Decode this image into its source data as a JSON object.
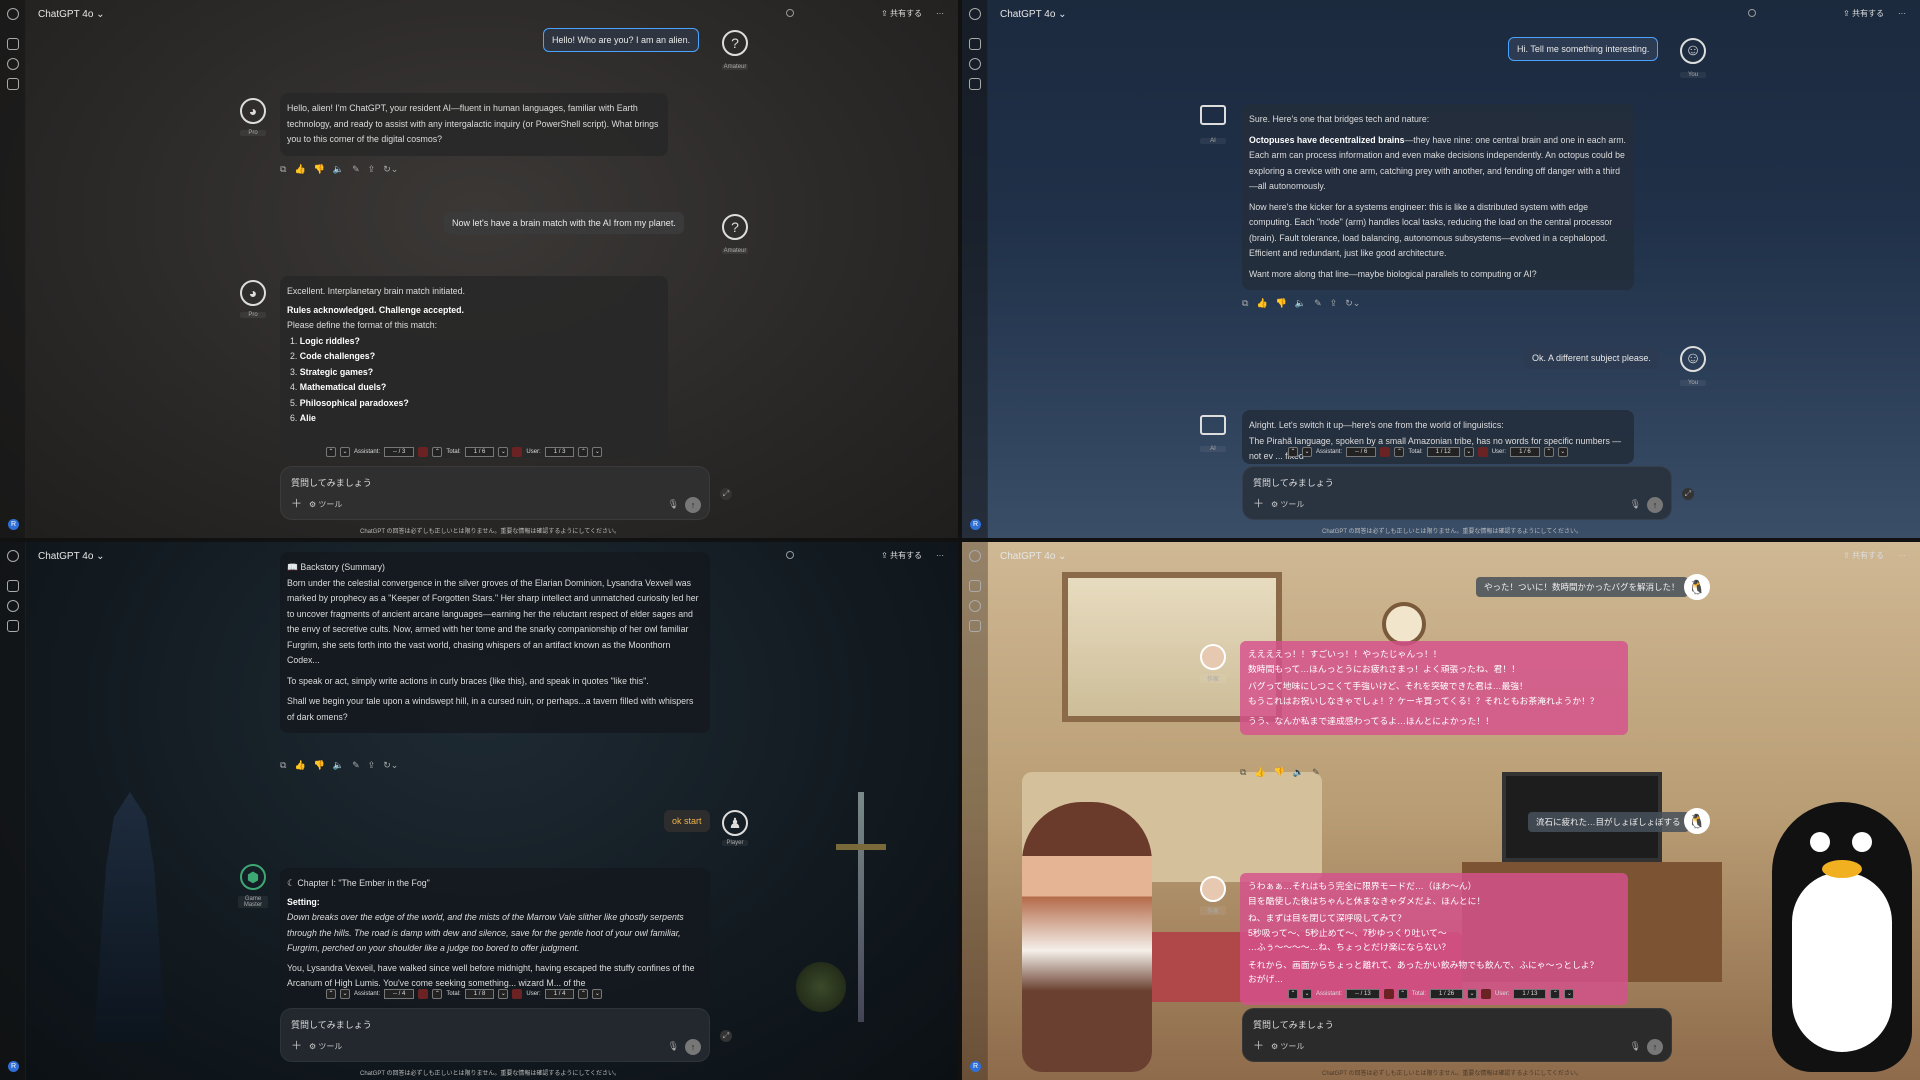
{
  "app_name": "ChatGPT 4o",
  "share_label": "共有する",
  "more_label": "···",
  "composer": {
    "placeholder": "質問してみましょう",
    "tools": "ツール"
  },
  "disclaimer": "ChatGPT の回答は必ずしも正しいとは限りません。重要な情報は確認するようにしてください。",
  "avatar_initial": "R",
  "nav_labels": {
    "assistant": "Assistant:",
    "total": "Total:",
    "user": "User:"
  },
  "pane1": {
    "user1": "Hello! Who are you? I am an alien.",
    "user_label": "Amateur",
    "ai_label": "Pro",
    "ai1": "Hello, alien! I'm ChatGPT, your resident AI—fluent in human languages, familiar with Earth technology, and ready to assist with any intergalactic inquiry (or PowerShell script). What brings you to this corner of the digital cosmos?",
    "user2": "Now let's have a brain match with the AI from my planet.",
    "ai2_intro": "Excellent. Interplanetary brain match initiated.",
    "ai2_bold": "Rules acknowledged. Challenge accepted.",
    "ai2_prompt": "Please define the format of this match:",
    "ai2_items": [
      "Logic riddles?",
      "Code challenges?",
      "Strategic games?",
      "Mathematical duels?",
      "Philosophical paradoxes?",
      "Alie"
    ],
    "nav": {
      "assistant": "-- / 3",
      "total": "1 / 6",
      "user": "1 / 3"
    }
  },
  "pane2": {
    "user1": "Hi. Tell me something interesting.",
    "user_label": "You",
    "ai_label": "AI",
    "ai1_p1": "Sure. Here's one that bridges tech and nature:",
    "ai1_p2_bold": "Octopuses have decentralized brains",
    "ai1_p2": "—they have nine: one central brain and one in each arm. Each arm can process information and even make decisions independently. An octopus could be exploring a crevice with one arm, catching prey with another, and fending off danger with a third—all autonomously.",
    "ai1_p3": "Now here's the kicker for a systems engineer: this is like a distributed system with edge computing. Each \"node\" (arm) handles local tasks, reducing the load on the central processor (brain). Fault tolerance, load balancing, autonomous subsystems—evolved in a cephalopod. Efficient and redundant, just like good architecture.",
    "ai1_p4": "Want more along that line—maybe biological parallels to computing or AI?",
    "user2": "Ok. A different subject please.",
    "ai2_p1": "Alright. Let's switch it up—here's one from the world of linguistics:",
    "ai2_p2": "The Pirahã language, spoken by a small Amazonian tribe, has no words for specific numbers —not ev ... fixed",
    "nav": {
      "assistant": "-- / 6",
      "total": "1 / 12",
      "user": "1 / 6"
    }
  },
  "pane3": {
    "backstory_title": "Backstory (Summary)",
    "backstory": "Born under the celestial convergence in the silver groves of the Elarian Dominion, Lysandra Vexveil was marked by prophecy as a \"Keeper of Forgotten Stars.\" Her sharp intellect and unmatched curiosity led her to uncover fragments of ancient arcane languages—earning her the reluctant respect of elder sages and the envy of secretive cults. Now, armed with her tome and the snarky companionship of her owl familiar Furgrim, she sets forth into the vast world, chasing whispers of an artifact known as the Moonthorn Codex...",
    "instructions": "To speak or act, simply write actions in curly braces {like this}, and speak in quotes \"like this\".",
    "question": "Shall we begin your tale upon a windswept hill, in a cursed ruin, or perhaps...a tavern filled with whispers of dark omens?",
    "user1": "ok start",
    "user_label": "Player",
    "ai_label": "Game Master",
    "chapter": "Chapter I: \"The Ember in the Fog\"",
    "setting_label": "Setting:",
    "setting": "Down breaks over the edge of the world, and the mists of the Marrow Vale slither like ghostly serpents through the hills. The road is damp with dew and silence, save for the gentle hoot of your owl familiar, Furgrim, perched on your shoulder like a judge too bored to offer judgment.",
    "story": "You, Lysandra Vexveil, have walked since well before midnight, having escaped the stuffy confines of the Arcanum of High Lumis. You've come seeking something... wizard M... of the",
    "nav": {
      "assistant": "-- / 4",
      "total": "1 / 8",
      "user": "1 / 4"
    }
  },
  "pane4": {
    "user1": "やった！ついに！数時間かかったバグを解消した！",
    "ai_label": "作家",
    "ai1_lines": [
      "ええええっ！！すごいっ！！やったじゃんっ！！",
      "数時間もって…ほんっとうにお疲れさまっ！よく頑張ったね、君！！",
      "バグって地味にしつこくて手強いけど、それを突破できた君は…最強！",
      "もうこれはお祝いしなきゃでしょ！？ケーキ買ってくる！？それともお茶淹れようか！？",
      "うう、なんか私まで達成感わってるよ…ほんとによかった！！"
    ],
    "user2": "流石に疲れた…目がしょぼしょぼする",
    "ai2_lines": [
      "うわぁぁ…それはもう完全に限界モードだ…（ほわ〜ん）",
      "目を酷使した後はちゃんと休まなきゃダメだよ、ほんとに！",
      "ね、まずは目を閉じて深呼吸してみて？",
      "5秒吸って〜、5秒止めて〜、7秒ゆっくり吐いて〜",
      "…ふぅ〜〜〜〜…ね、ちょっとだけ楽にならない？",
      "それから、画面からちょっと離れて、あったかい飲み物でも飲んで、ふにゃ〜っとしよ？",
      "おがげ…"
    ],
    "nav": {
      "assistant": "-- / 13",
      "total": "1 / 26",
      "user": "1 / 13"
    }
  }
}
